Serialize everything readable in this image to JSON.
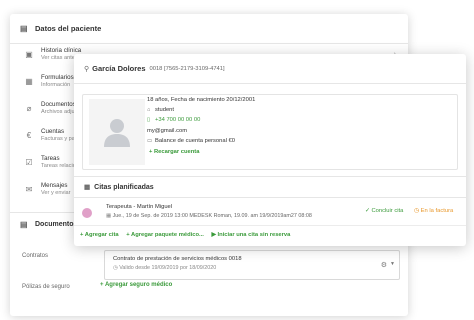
{
  "patient_data": {
    "title": "Datos del paciente",
    "items": [
      {
        "label": "Historia clínica",
        "sub": "Ver citas anteriores",
        "icon": "medical-history-icon"
      },
      {
        "label": "Formularios",
        "sub": "Información",
        "icon": "forms-icon"
      },
      {
        "label": "Documentos",
        "sub": "Archivos adjuntos",
        "icon": "paperclip-icon"
      },
      {
        "label": "Cuentas",
        "sub": "Facturas y pagos",
        "icon": "money-icon"
      },
      {
        "label": "Tareas",
        "sub": "Tareas relacionadas",
        "icon": "tasks-icon"
      },
      {
        "label": "Mensajes",
        "sub": "Ver y enviar",
        "icon": "envelope-icon"
      }
    ]
  },
  "documents": {
    "title": "Documentos",
    "contracts_label": "Contratos",
    "contract_title": "Contrato de prestación de servicios médicos 0018",
    "contract_valid": "Valido desde 19/09/2019 por 18/09/2020",
    "insurance_label": "Pólizas de seguro",
    "add_insurance": "+ Agregar seguro médico"
  },
  "patient": {
    "name": "García Dolores",
    "ids": "0018 [7565-2179-3109-4741]",
    "age_birth": "18 años, Fecha de nacimiento 20/12/2001",
    "occupation": "student",
    "phone": "+34 700 00 00 00",
    "email": "my@gmail.com",
    "balance": "Balance de cuenta personal  €0",
    "recharge": "+ Recargar cuenta"
  },
  "appointments": {
    "title": "Citas planificadas",
    "items": [
      {
        "therapist": "Terapeuta - Martín Miguel",
        "details": "Jue., 19 de Sep. de 2019 13:00   MEDESK Roman, 19.09. am 19/9/2019am27 08:08",
        "complete": "Concluir cita",
        "in_invoice": "En la factura",
        "color": "#e0a0c8"
      }
    ],
    "actions": {
      "add_appointment": "+ Agregar cita",
      "add_package": "+ Agregar paquete médico...",
      "start_unbooked": "Iniciar una cita sin reserva"
    }
  },
  "colors": {
    "accent_green": "#3a9a3a",
    "accent_orange": "#e8972a"
  }
}
